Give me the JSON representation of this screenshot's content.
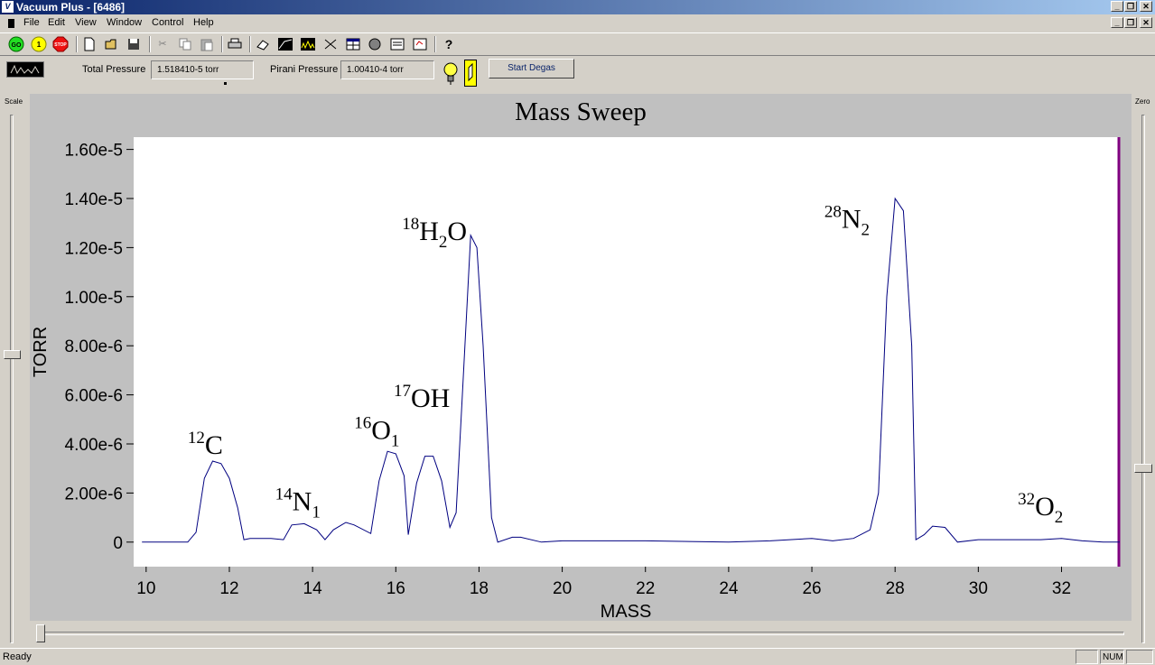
{
  "window": {
    "title": "Vacuum Plus - [6486]"
  },
  "menu": [
    "File",
    "Edit",
    "View",
    "Window",
    "Control",
    "Help"
  ],
  "toolbar": {
    "go": "GO",
    "one": "1",
    "stop": "STOP",
    "help": "?"
  },
  "status_strip": {
    "total_pressure_label": "Total Pressure",
    "total_pressure_value": "1.518410-5 torr",
    "pirani_label": "Pirani Pressure",
    "pirani_value": "1.00410-4 torr",
    "degas_button": "Start Degas"
  },
  "sliders": {
    "scale_label": "Scale",
    "zero_label": "Zero"
  },
  "statusbar": {
    "text": "Ready",
    "num": "NUM"
  },
  "chart_data": {
    "type": "line",
    "title": "Mass Sweep",
    "xlabel": "MASS",
    "ylabel": "TORR",
    "xlim": [
      9.7,
      33.4
    ],
    "ylim": [
      -1e-06,
      1.65e-05
    ],
    "x_ticks": [
      {
        "v": 10,
        "label": "10"
      },
      {
        "v": 12,
        "label": "12"
      },
      {
        "v": 14,
        "label": "14"
      },
      {
        "v": 16,
        "label": "16"
      },
      {
        "v": 18,
        "label": "18"
      },
      {
        "v": 20,
        "label": "20"
      },
      {
        "v": 22,
        "label": "22"
      },
      {
        "v": 24,
        "label": "24"
      },
      {
        "v": 26,
        "label": "26"
      },
      {
        "v": 28,
        "label": "28"
      },
      {
        "v": 30,
        "label": "30"
      },
      {
        "v": 32,
        "label": "32"
      }
    ],
    "y_ticks": [
      {
        "v": 0,
        "label": "0"
      },
      {
        "v": 2e-06,
        "label": "2.00e-6"
      },
      {
        "v": 4e-06,
        "label": "4.00e-6"
      },
      {
        "v": 6e-06,
        "label": "6.00e-6"
      },
      {
        "v": 8e-06,
        "label": "8.00e-6"
      },
      {
        "v": 1e-05,
        "label": "1.00e-5"
      },
      {
        "v": 1.2e-05,
        "label": "1.20e-5"
      },
      {
        "v": 1.4e-05,
        "label": "1.40e-5"
      },
      {
        "v": 1.6e-05,
        "label": "1.60e-5"
      }
    ],
    "series": [
      {
        "x": [
          9.9,
          10.5,
          11.0,
          11.2,
          11.4,
          11.6,
          11.8,
          12.0,
          12.2,
          12.35,
          12.5,
          13.0,
          13.3,
          13.5,
          13.8,
          14.1,
          14.3,
          14.5,
          14.8,
          15.0,
          15.4,
          15.6,
          15.8,
          16.0,
          16.2,
          16.3,
          16.5,
          16.7,
          16.9,
          17.1,
          17.3,
          17.45,
          17.6,
          17.8,
          17.95,
          18.1,
          18.3,
          18.45,
          18.8,
          19.0,
          19.5,
          20,
          22,
          24,
          25,
          26,
          26.5,
          27.0,
          27.4,
          27.6,
          27.8,
          28.0,
          28.2,
          28.4,
          28.5,
          28.7,
          28.9,
          29.2,
          29.5,
          30,
          30.5,
          31.5,
          32,
          32.5,
          33,
          33.4
        ],
        "y": [
          0,
          0,
          0,
          4e-07,
          2.6e-06,
          3.3e-06,
          3.2e-06,
          2.6e-06,
          1.4e-06,
          1e-07,
          1.5e-07,
          1.5e-07,
          1e-07,
          7e-07,
          7.5e-07,
          5e-07,
          1e-07,
          5e-07,
          8e-07,
          7e-07,
          3.5e-07,
          2.5e-06,
          3.7e-06,
          3.6e-06,
          2.7e-06,
          3e-07,
          2.4e-06,
          3.5e-06,
          3.5e-06,
          2.5e-06,
          6e-07,
          1.2e-06,
          6e-06,
          1.25e-05,
          1.2e-05,
          8e-06,
          1e-06,
          0,
          2e-07,
          2e-07,
          0,
          5e-08,
          5e-08,
          0,
          5e-08,
          1.5e-07,
          5e-08,
          1.5e-07,
          5e-07,
          2e-06,
          1e-05,
          1.4e-05,
          1.35e-05,
          8e-06,
          1e-07,
          3e-07,
          6.5e-07,
          6e-07,
          0,
          1e-07,
          1e-07,
          1e-07,
          1.5e-07,
          5e-08,
          0,
          0
        ]
      }
    ],
    "annotations": [
      {
        "mass": "12",
        "species": "C",
        "sub": "",
        "x": 11.0,
        "y": 3.6e-06
      },
      {
        "mass": "14",
        "species": "N",
        "sub": "1",
        "x": 13.1,
        "y": 1.3e-06
      },
      {
        "mass": "16",
        "species": "O",
        "sub": "1",
        "x": 15.0,
        "y": 4.2e-06
      },
      {
        "mass": "17",
        "species": "OH",
        "sub": "",
        "x": 15.95,
        "y": 5.5e-06
      },
      {
        "mass": "18",
        "species": "H",
        "sub": "2",
        "tail": "O",
        "x": 16.15,
        "y": 1.23e-05
      },
      {
        "mass": "28",
        "species": "N",
        "sub": "2",
        "x": 26.3,
        "y": 1.28e-05
      },
      {
        "mass": "32",
        "species": "O",
        "sub": "2",
        "x": 30.95,
        "y": 1.1e-06
      }
    ]
  }
}
